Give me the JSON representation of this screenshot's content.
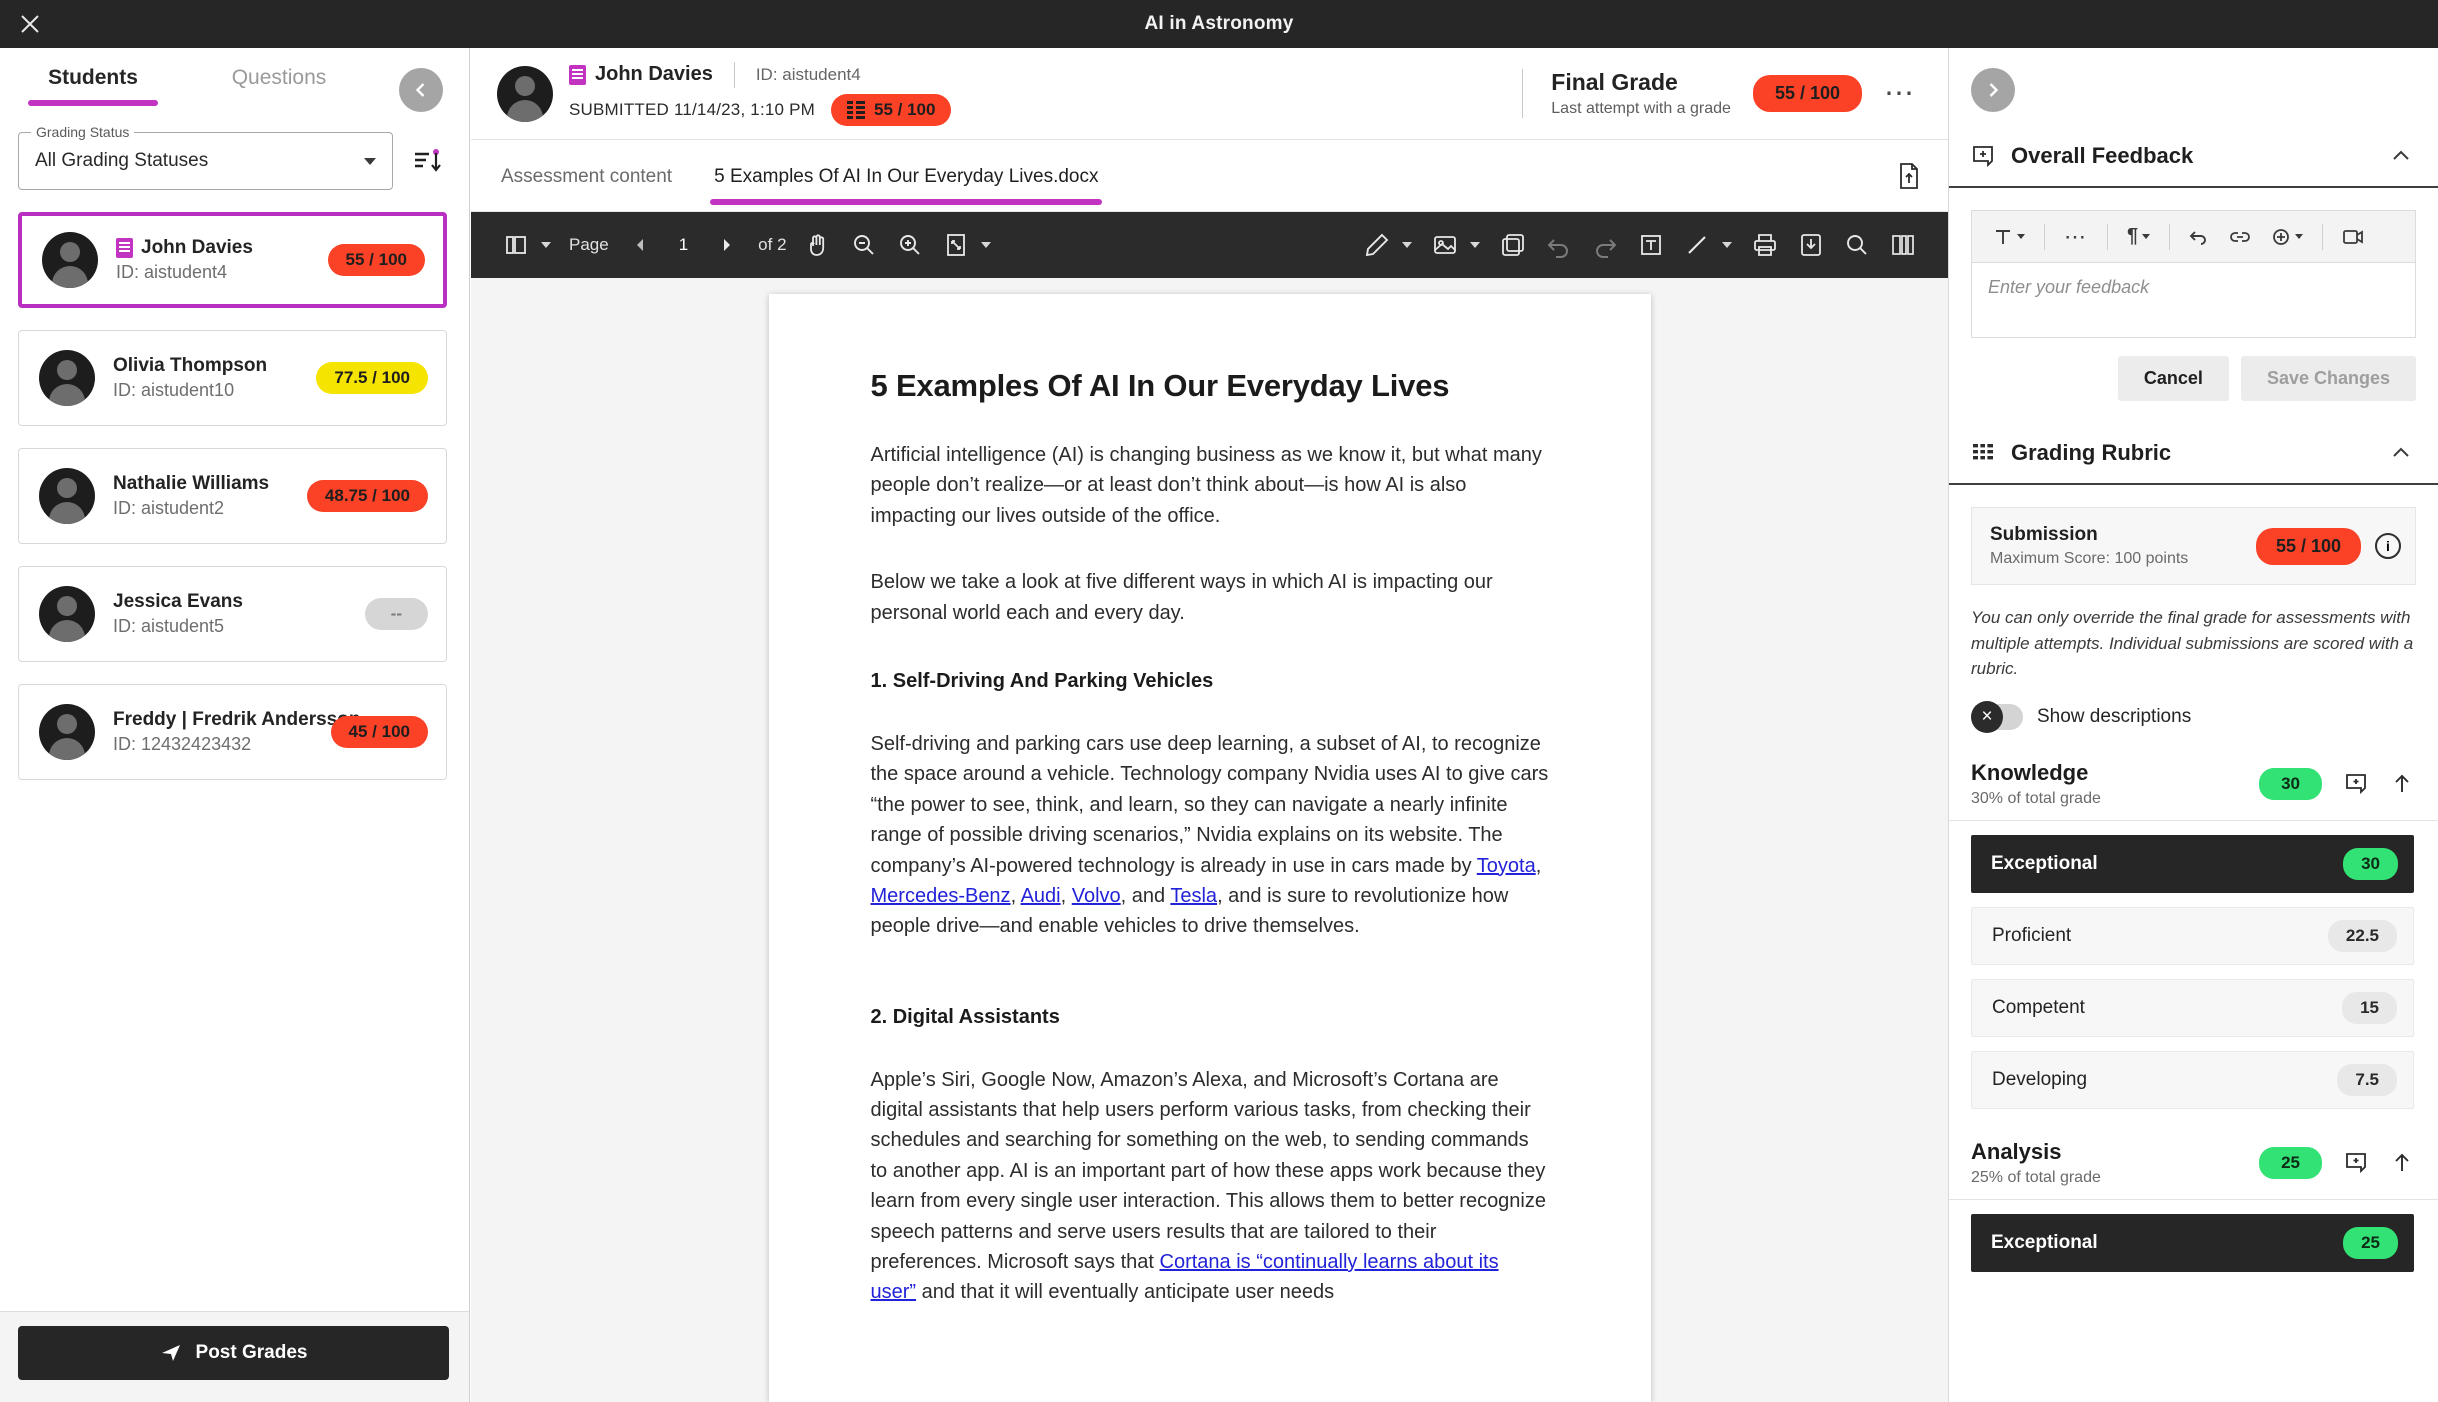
{
  "topbar": {
    "title": "AI in Astronomy",
    "close_icon": "close-icon"
  },
  "left": {
    "tabs": [
      {
        "label": "Students",
        "active": true
      },
      {
        "label": "Questions",
        "active": false
      }
    ],
    "collapse_icon": "chevron-left-icon",
    "filter": {
      "legend": "Grading Status",
      "value": "All Grading Statuses",
      "sort_icon": "sort-icon"
    },
    "students": [
      {
        "name": "John Davies",
        "id": "ID: aistudent4",
        "score": "55 / 100",
        "tone": "red",
        "selected": true,
        "has_doc_badge": true
      },
      {
        "name": "Olivia Thompson",
        "id": "ID: aistudent10",
        "score": "77.5 / 100",
        "tone": "yellow",
        "selected": false,
        "has_doc_badge": false
      },
      {
        "name": "Nathalie Williams",
        "id": "ID: aistudent2",
        "score": "48.75 / 100",
        "tone": "red",
        "selected": false,
        "has_doc_badge": false
      },
      {
        "name": "Jessica Evans",
        "id": "ID: aistudent5",
        "score": "--",
        "tone": "grey",
        "selected": false,
        "has_doc_badge": false
      },
      {
        "name": "Freddy | Fredrik Andersson",
        "id": "ID: 12432423432",
        "score": "45 / 100",
        "tone": "red",
        "selected": false,
        "has_doc_badge": false
      }
    ],
    "post_grades_label": "Post Grades",
    "post_grades_icon": "send-icon"
  },
  "submission_header": {
    "student_name": "John Davies",
    "student_id": "ID: aistudent4",
    "submitted_text": "SUBMITTED 11/14/23, 1:10 PM",
    "submitted_score": "55 / 100",
    "final_grade_title": "Final Grade",
    "final_grade_sub": "Last attempt with a grade",
    "final_grade_score": "55 / 100",
    "overflow_icon": "more-horizontal-icon"
  },
  "doc_tabs": [
    {
      "label": "Assessment content",
      "active": false
    },
    {
      "label": "5 Examples Of AI In Our Everyday Lives.docx",
      "active": true
    }
  ],
  "doc_tabs_right_icon": "document-icon",
  "viewer_toolbar": {
    "layout_icon": "page-layout-icon",
    "page_label": "Page",
    "prev_icon": "prev-page-icon",
    "page_number": "1",
    "next_icon": "next-page-icon",
    "of_label": "of 2",
    "pan_icon": "hand-pan-icon",
    "zoom_out_icon": "zoom-out-icon",
    "zoom_in_icon": "zoom-in-icon",
    "fit_icon": "fit-page-icon",
    "pen_icon": "pen-annotate-icon",
    "image_icon": "image-annotate-icon",
    "stamp_icon": "stamp-icon",
    "undo_icon": "undo-icon",
    "redo_icon": "redo-icon",
    "textbox_icon": "text-box-icon",
    "line_icon": "line-icon",
    "print_icon": "print-icon",
    "download_icon": "download-icon",
    "search_icon": "search-icon",
    "thumbnails_icon": "thumbnails-icon"
  },
  "document": {
    "title": "5 Examples Of AI In Our Everyday Lives",
    "paragraphs": [
      "Artificial intelligence (AI) is changing business as we know it, but what many people don’t realize—or at least don’t think about—is how AI is also impacting our lives outside of the office.",
      "Below we take a look at five different ways in which AI is impacting our personal world each and every day."
    ],
    "section1_heading": "1. Self-Driving And Parking Vehicles",
    "section1_body_a": "Self-driving and parking cars use deep learning, a subset of AI, to recognize the space around a vehicle. Technology company Nvidia uses AI to give cars “the power to see, think, and learn, so they can navigate a nearly infinite range of possible driving scenarios,” Nvidia explains on its website. The company’s AI-powered technology is already in use in cars made by ",
    "section1_links": [
      "Toyota",
      "Mercedes-Benz",
      "Audi",
      "Volvo",
      "Tesla"
    ],
    "section1_body_b": ", and is sure to revolutionize how people drive—and enable vehicles to drive themselves.",
    "section2_heading": "2. Digital Assistants",
    "section2_body_a": "Apple’s Siri, Google Now, Amazon’s Alexa, and Microsoft’s Cortana are digital assistants that help users perform various tasks, from checking their schedules and searching for something on the web, to sending commands to another app. AI is an important part of how these apps work because they learn from every single user interaction. This allows them to better recognize speech patterns and serve users results that are tailored to their preferences. Microsoft says that ",
    "section2_link": "Cortana is “continually learns about its user”",
    "section2_body_b": " and that it will eventually anticipate user needs"
  },
  "right": {
    "expand_icon": "chevron-right-icon",
    "overall_feedback": {
      "title": "Overall Feedback",
      "icon": "feedback-icon",
      "collapse_icon": "chevron-up-icon",
      "toolbar_icons": [
        "text-format-icon",
        "more-options-icon",
        "paragraph-icon",
        "undo-icon",
        "link-icon",
        "insert-icon",
        "media-icon"
      ],
      "placeholder": "Enter your feedback",
      "cancel_label": "Cancel",
      "save_label": "Save Changes"
    },
    "grading_rubric": {
      "title": "Grading Rubric",
      "icon": "rubric-icon",
      "collapse_icon": "chevron-up-icon",
      "submission": {
        "title": "Submission",
        "subtitle": "Maximum Score: 100 points",
        "score": "55 / 100",
        "info_icon": "info-icon"
      },
      "note": "You can only override the final grade for assessments with multiple attempts. Individual submissions are scored with a rubric.",
      "show_descriptions_label": "Show descriptions",
      "show_descriptions_on": false,
      "criteria": [
        {
          "name": "Knowledge",
          "weight": "30% of total grade",
          "score": "30",
          "feedback_icon": "feedback-icon",
          "expand_icon": "arrow-up-icon",
          "levels": [
            {
              "label": "Exceptional",
              "value": "30",
              "selected": true
            },
            {
              "label": "Proficient",
              "value": "22.5",
              "selected": false
            },
            {
              "label": "Competent",
              "value": "15",
              "selected": false
            },
            {
              "label": "Developing",
              "value": "7.5",
              "selected": false
            }
          ]
        },
        {
          "name": "Analysis",
          "weight": "25% of total grade",
          "score": "25",
          "feedback_icon": "feedback-icon",
          "expand_icon": "arrow-up-icon",
          "levels": [
            {
              "label": "Exceptional",
              "value": "25",
              "selected": true
            }
          ]
        }
      ]
    }
  },
  "colors": {
    "accent_purple": "#c233c2",
    "score_red": "#fb4227",
    "score_yellow": "#f5e400",
    "score_green": "#32e274",
    "dark": "#262626"
  }
}
